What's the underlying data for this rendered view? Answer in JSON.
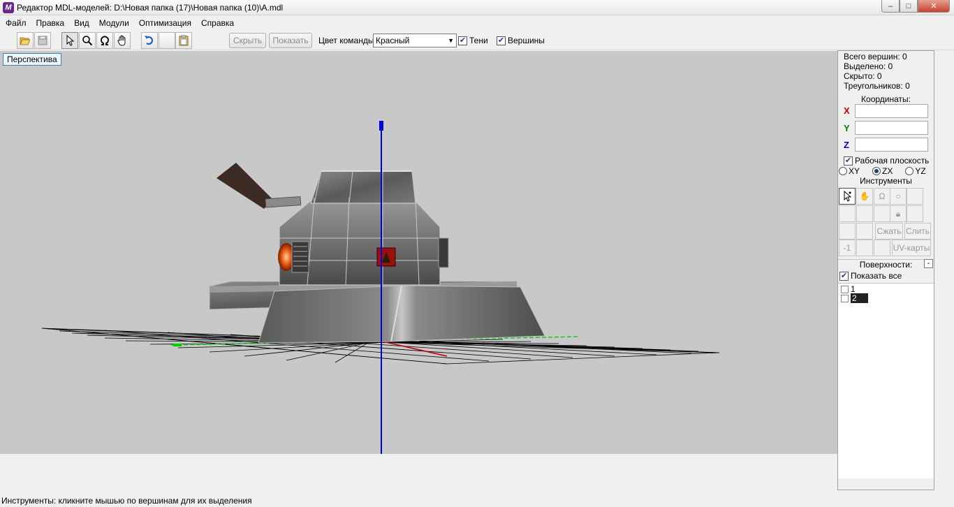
{
  "window": {
    "title": "Редактор MDL-моделей: D:\\Новая папка (17)\\Новая папка (10)\\A.mdl",
    "controls": {
      "minimize": "–",
      "maximize": "□",
      "close": "✕"
    }
  },
  "menu": [
    "Файл",
    "Правка",
    "Вид",
    "Модули",
    "Оптимизация",
    "Справка"
  ],
  "toolbar": {
    "hide_label": "Скрыть",
    "show_label": "Показать",
    "team_color_label": "Цвет команды:",
    "team_color_value": "Красный",
    "shadows_label": "Тени",
    "shadows_checked": true,
    "vertices_label": "Вершины",
    "vertices_checked": true
  },
  "viewport": {
    "mode_label": "Перспектива",
    "background": "#c8c8c8"
  },
  "stats": {
    "total_vertices": "Всего вершин: 0",
    "selected": "Выделено: 0",
    "hidden": "Скрыто: 0",
    "triangles": "Треугольников: 0"
  },
  "coords": {
    "heading": "Координаты:",
    "x_label": "X",
    "y_label": "Y",
    "z_label": "Z",
    "x_value": "",
    "y_value": "",
    "z_value": "",
    "x_color": "#cc0000",
    "y_color": "#008800",
    "z_color": "#0000cc"
  },
  "work_plane": {
    "label": "Рабочая плоскость",
    "checked": true,
    "options": [
      "XY",
      "ZX",
      "YZ"
    ],
    "selected": "ZX"
  },
  "tools": {
    "heading": "Инструменты",
    "compress_label": "Сжать",
    "merge_label": "Слить",
    "uv_label": "UV-карты",
    "minus_one": "-1"
  },
  "surfaces": {
    "heading": "Поверхности:",
    "collapse": "-",
    "show_all_label": "Показать все",
    "show_all_checked": true,
    "items": [
      "1",
      "2"
    ],
    "selected_item": "2"
  },
  "status": "Инструменты: кликните мышью по вершинам для их выделения"
}
